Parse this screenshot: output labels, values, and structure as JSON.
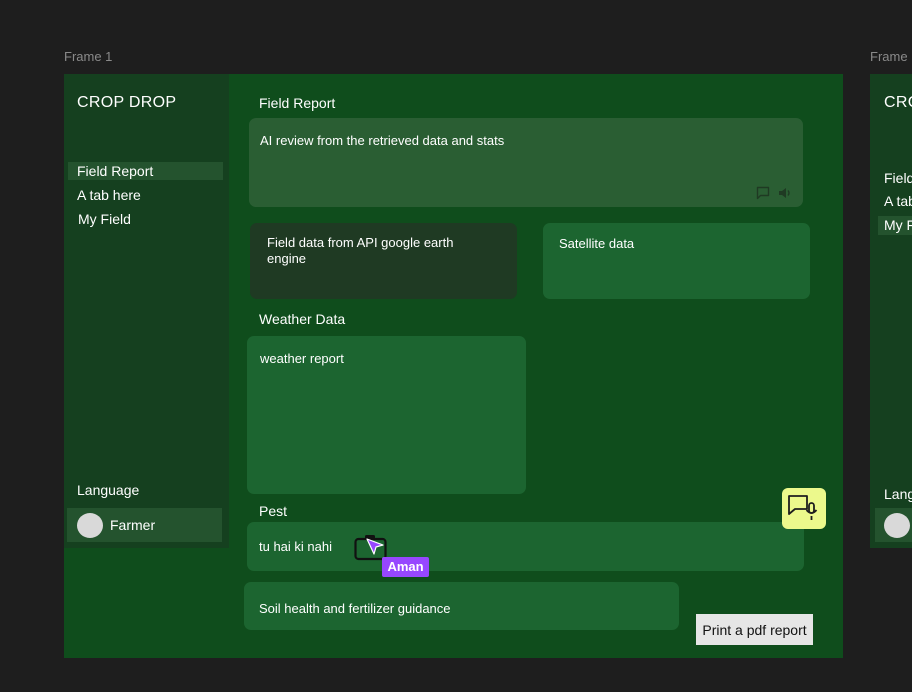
{
  "canvas": {
    "frame1_label": "Frame 1",
    "frame2_label": "Frame"
  },
  "app": {
    "brand": "CROP DROP",
    "nav": [
      "Field Report",
      "A tab here",
      "My Field"
    ],
    "language_label": "Language",
    "user_name": "Farmer"
  },
  "main": {
    "field_report_label": "Field Report",
    "ai_review_text": "AI review from the retrieved data and stats",
    "api_data_text": "Field data from API google earth engine",
    "satellite_text": "Satellite data",
    "weather_label": "Weather Data",
    "weather_text": "weather report",
    "pest_label": "Pest",
    "pest_text": "tu hai ki nahi",
    "soil_text": "Soil health and fertilizer guidance",
    "print_button": "Print a pdf report"
  },
  "collaborator": {
    "name": "Aman",
    "color": "#9747ff"
  },
  "frame2": {
    "brand": "CRC",
    "nav": [
      "Field",
      "A tab",
      "My F"
    ],
    "language_label": "Lang"
  },
  "colors": {
    "canvas_bg": "#1e1e1e",
    "frame_bg": "#0f4d1c",
    "sidebar_bg": "#15401f",
    "card_green": "#1c6530",
    "fab_bg": "#ecf98c"
  },
  "icons": {
    "comment": "comment-icon",
    "speaker": "speaker-icon",
    "voice_chat": "voice-chat-icon",
    "camera": "camera-icon",
    "cursor": "cursor-icon"
  }
}
